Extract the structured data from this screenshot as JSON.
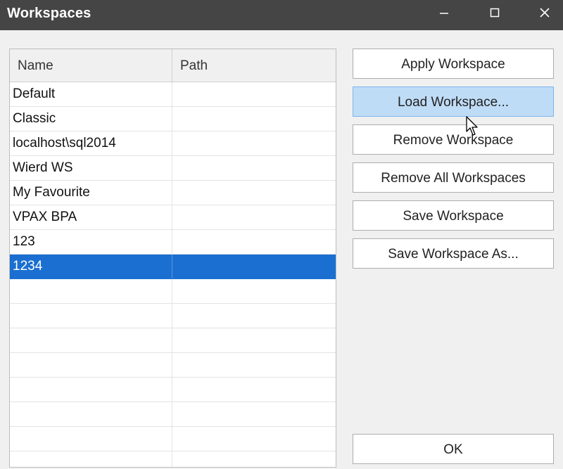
{
  "window": {
    "title": "Workspaces",
    "controls": {
      "minimize": "minimize-icon",
      "maximize": "maximize-icon",
      "close": "close-icon"
    }
  },
  "list": {
    "columns": [
      "Name",
      "Path"
    ],
    "rows": [
      {
        "name": "Default",
        "path": ""
      },
      {
        "name": "Classic",
        "path": ""
      },
      {
        "name": "localhost\\sql2014",
        "path": ""
      },
      {
        "name": "Wierd WS",
        "path": ""
      },
      {
        "name": "My Favourite",
        "path": ""
      },
      {
        "name": "VPAX BPA",
        "path": ""
      },
      {
        "name": "123",
        "path": ""
      },
      {
        "name": "1234",
        "path": ""
      }
    ],
    "selected_row": "1234"
  },
  "buttons": {
    "apply": "Apply Workspace",
    "load": "Load Workspace...",
    "remove": "Remove Workspace",
    "remove_all": "Remove All Workspaces",
    "save": "Save Workspace",
    "save_as": "Save Workspace As...",
    "ok": "OK"
  },
  "colors": {
    "titlebar": "#454545",
    "selection": "#1a6fd1",
    "button_hover": "#bfdcf7"
  }
}
